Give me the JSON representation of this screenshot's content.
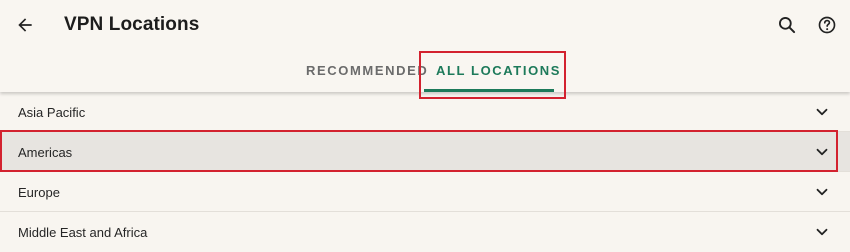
{
  "header": {
    "title": "VPN Locations",
    "back_icon": "arrow-left-icon",
    "search_icon": "search-icon",
    "help_icon": "help-circle-icon"
  },
  "tabs": [
    {
      "label": "RECOMMENDED",
      "active": false
    },
    {
      "label": "ALL LOCATIONS",
      "active": true
    }
  ],
  "regions": [
    {
      "label": "Asia Pacific",
      "expanded": false,
      "highlighted": false
    },
    {
      "label": "Americas",
      "expanded": false,
      "highlighted": true
    },
    {
      "label": "Europe",
      "expanded": false,
      "highlighted": false
    },
    {
      "label": "Middle East and Africa",
      "expanded": false,
      "highlighted": false
    }
  ],
  "colors": {
    "accent": "#1d7a5a",
    "highlight_border": "#d3222f",
    "background": "#f8f5f0",
    "selected_row": "#e7e4e0"
  }
}
